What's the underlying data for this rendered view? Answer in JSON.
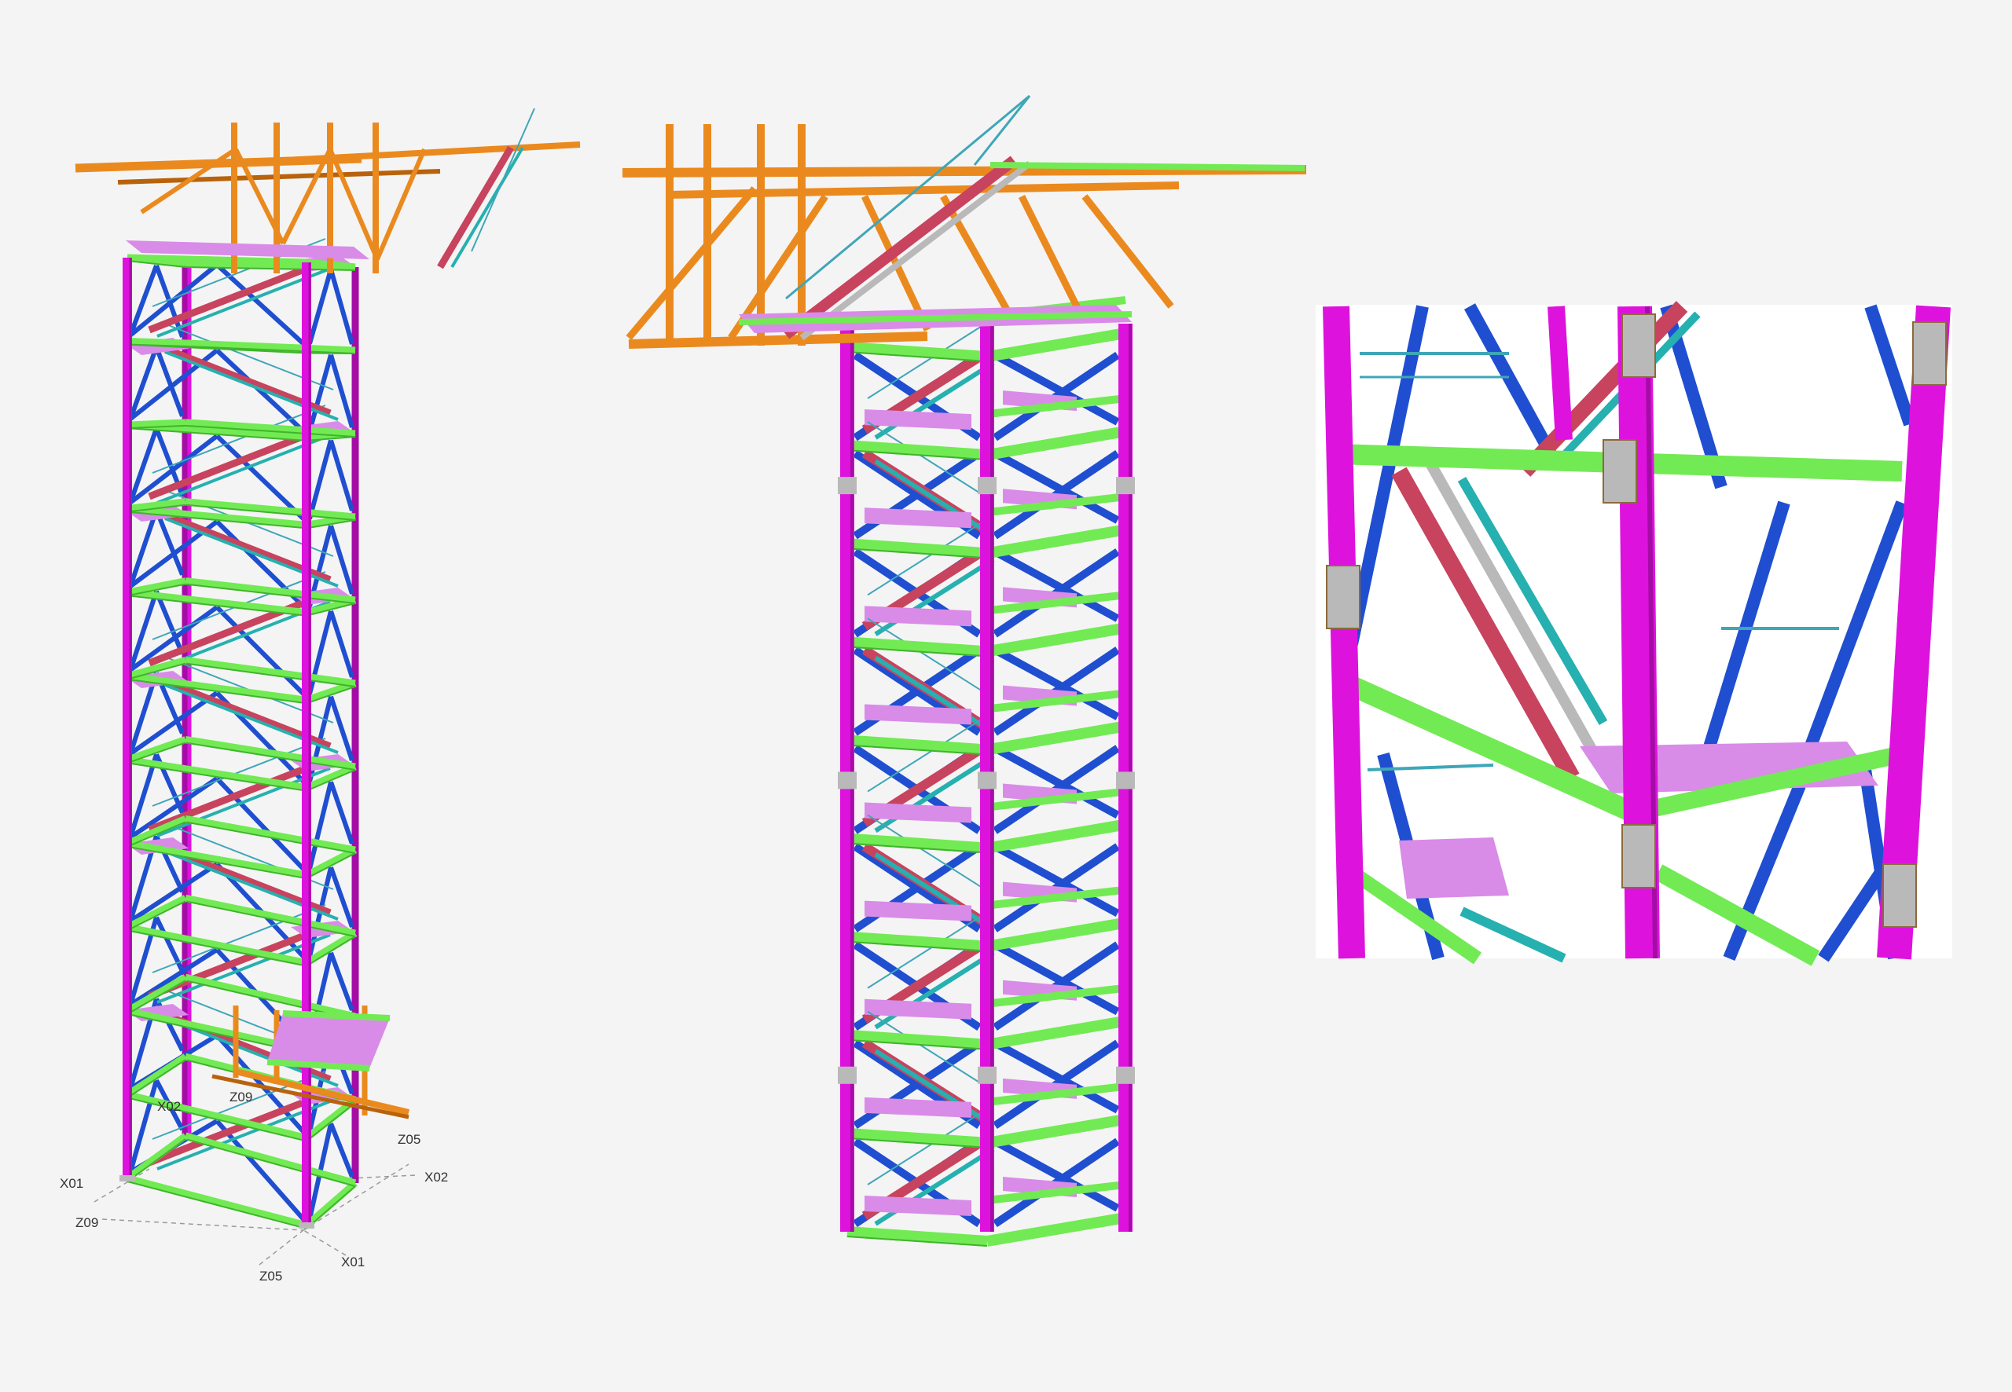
{
  "colors": {
    "background": "#f4f4f4",
    "column": "#dd13dd",
    "column_dark": "#a50ca5",
    "beam": "#72ea54",
    "beam_dark": "#3fb52b",
    "brace": "#1f4fd0",
    "stair_stringer": "#c8435e",
    "tread": "#26b0b0",
    "railing": "#3fa6b8",
    "landing_plate": "#d98be8",
    "support_frame": "#ea8a1e",
    "support_frame_dark": "#b8620c",
    "connection_plate": "#b9b9b9"
  },
  "views": [
    {
      "name": "overall-isometric-view"
    },
    {
      "name": "top-closeup-view"
    },
    {
      "name": "detail-closeup-view"
    }
  ],
  "grid_labels": [
    {
      "id": "x02-top",
      "text": "X02"
    },
    {
      "id": "z09-top",
      "text": "Z09"
    },
    {
      "id": "z05-right",
      "text": "Z05"
    },
    {
      "id": "x02-right",
      "text": "X02"
    },
    {
      "id": "x01-left",
      "text": "X01"
    },
    {
      "id": "z09-left",
      "text": "Z09"
    },
    {
      "id": "z05-bottom",
      "text": "Z05"
    },
    {
      "id": "x01-bottom",
      "text": "X01"
    }
  ]
}
